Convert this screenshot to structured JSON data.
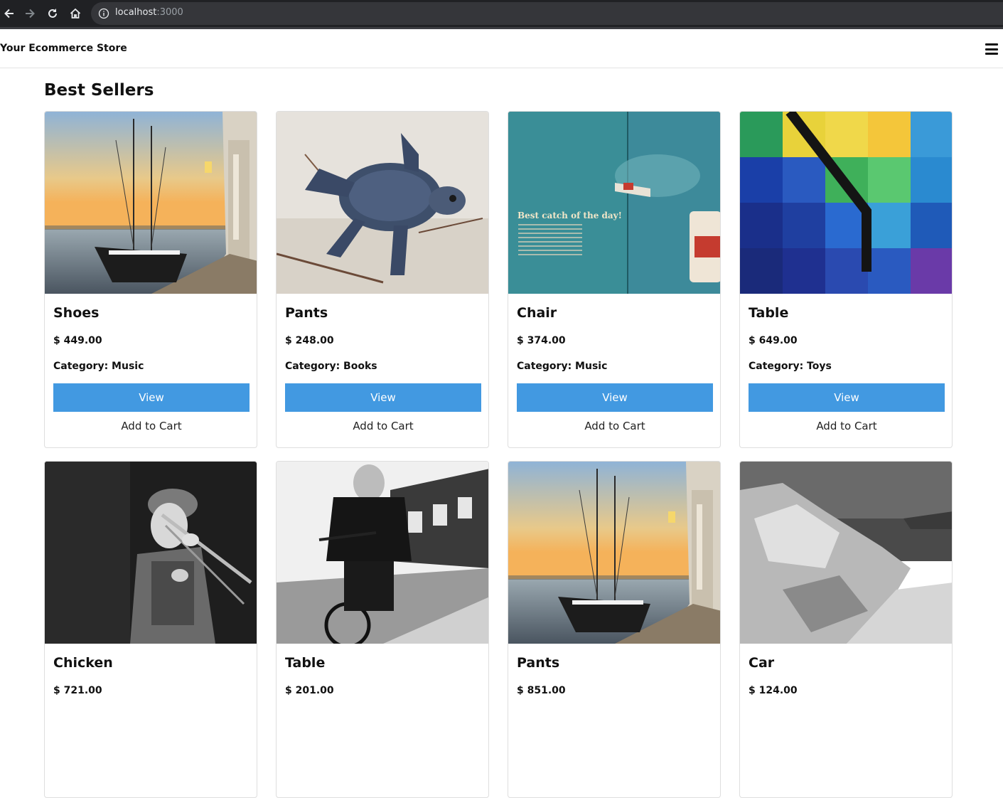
{
  "browser": {
    "url_host": "localhost",
    "url_port": ":3000"
  },
  "navbar": {
    "brand": "Your Ecommerce Store"
  },
  "section": {
    "title": "Best Sellers"
  },
  "labels": {
    "view": "View",
    "add_to_cart": "Add to Cart"
  },
  "products": [
    {
      "name": "Shoes",
      "price": "$ 449.00",
      "category": "Category: Music",
      "image": "sailboat-harbor"
    },
    {
      "name": "Pants",
      "price": "$ 248.00",
      "category": "Category: Books",
      "image": "baby-sea-turtle"
    },
    {
      "name": "Chair",
      "price": "$ 374.00",
      "category": "Category: Music",
      "image": "vintage-magazine-ad"
    },
    {
      "name": "Table",
      "price": "$ 649.00",
      "category": "Category: Toys",
      "image": "colorful-brick-wall"
    },
    {
      "name": "Chicken",
      "price": "$ 721.00",
      "category": "",
      "image": "trombone-player-bw"
    },
    {
      "name": "Table",
      "price": "$ 201.00",
      "category": "",
      "image": "cyclist-street-bw"
    },
    {
      "name": "Pants",
      "price": "$ 851.00",
      "category": "",
      "image": "sailboat-harbor"
    },
    {
      "name": "Car",
      "price": "$ 124.00",
      "category": "",
      "image": "rocky-coast-bw"
    }
  ],
  "magazine_ad": {
    "headline": "Best catch of the day!"
  }
}
